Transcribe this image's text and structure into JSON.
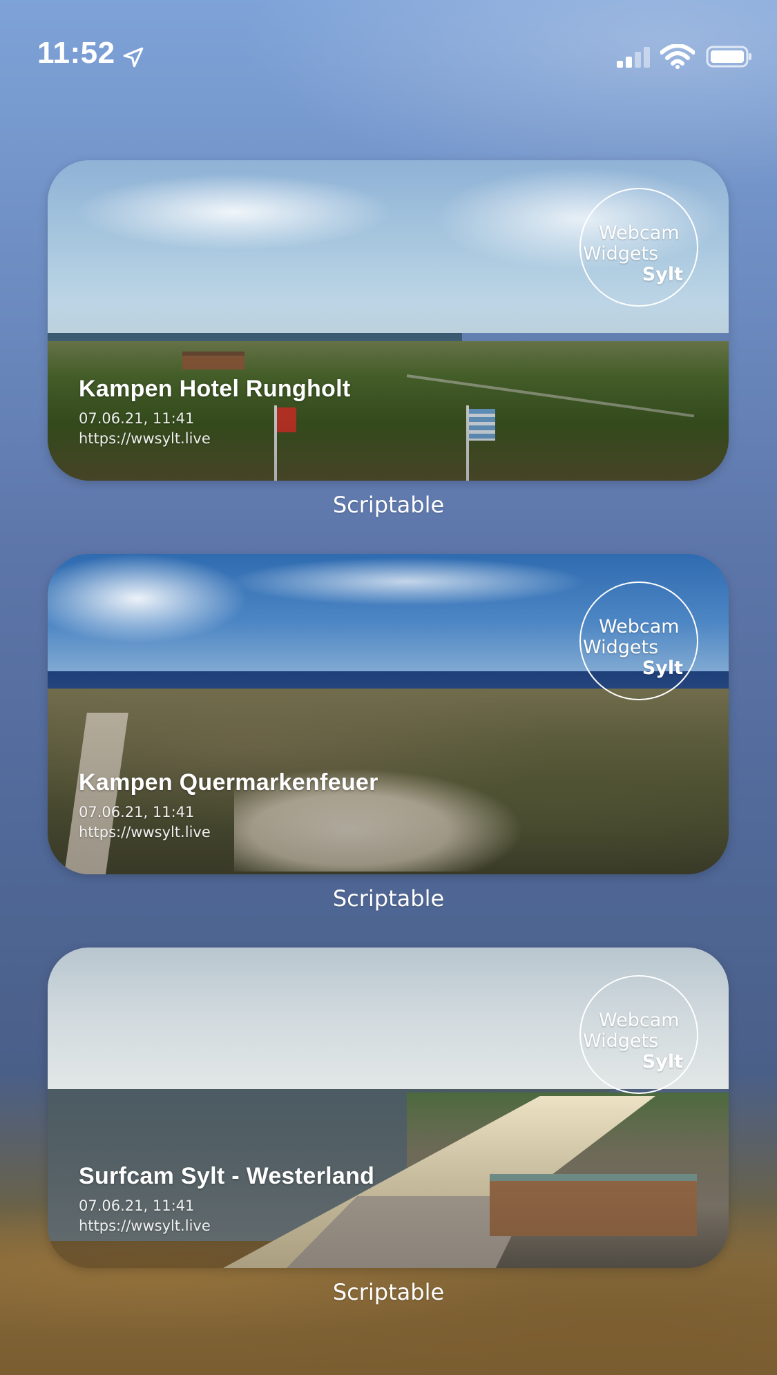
{
  "status_bar": {
    "time": "11:52",
    "location_icon": "location-arrow-icon",
    "signal_icon": "cellular-signal-icon",
    "wifi_icon": "wifi-icon",
    "battery_icon": "battery-icon"
  },
  "widgets": [
    {
      "title": "Kampen Hotel Rungholt",
      "timestamp": "07.06.21, 11:41",
      "url": "https://wwsylt.live",
      "badge": {
        "line1": "Webcam",
        "line2": "Widgets",
        "line3": "Sylt"
      },
      "app_label": "Scriptable"
    },
    {
      "title": "Kampen Quermarkenfeuer",
      "timestamp": "07.06.21, 11:41",
      "url": "https://wwsylt.live",
      "badge": {
        "line1": "Webcam",
        "line2": "Widgets",
        "line3": "Sylt"
      },
      "app_label": "Scriptable"
    },
    {
      "title": "Surfcam Sylt - Westerland",
      "timestamp": "07.06.21, 11:41",
      "url": "https://wwsylt.live",
      "badge": {
        "line1": "Webcam",
        "line2": "Widgets",
        "line3": "Sylt"
      },
      "app_label": "Scriptable"
    }
  ]
}
